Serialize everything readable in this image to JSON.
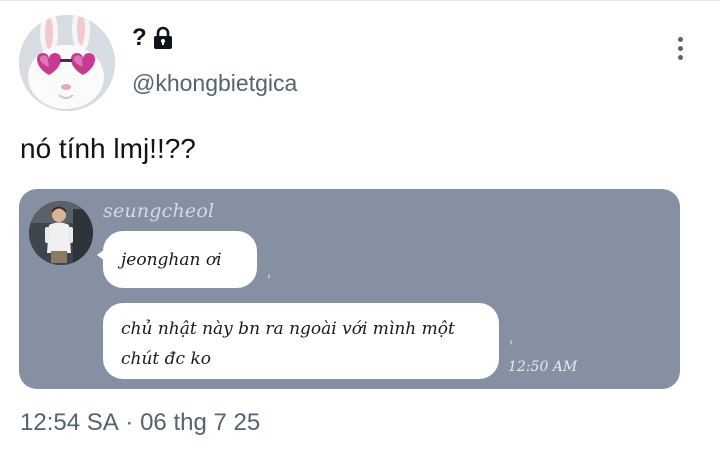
{
  "tweet": {
    "display_name": "?",
    "display_name_icon": "lock-icon",
    "handle": "@khongbietgica",
    "text": "nó tính lmj!!??",
    "time": "12:54 SA",
    "separator": " · ",
    "date": "06 thg 7 25"
  },
  "media": {
    "sender": "seungcheol",
    "messages": [
      {
        "text": "jeonghan ơi",
        "tick": "'"
      },
      {
        "text": "chủ nhật này bn ra ngoài với mình một chút đc ko",
        "tick": "'"
      }
    ],
    "time": "12:50 AM"
  },
  "icons": [
    "avatar-bunny-icon",
    "lock-icon",
    "more-vertical-icon"
  ],
  "colors": {
    "handle": "#536471",
    "media_bg": "#8591a3",
    "text": "#0f1419"
  }
}
